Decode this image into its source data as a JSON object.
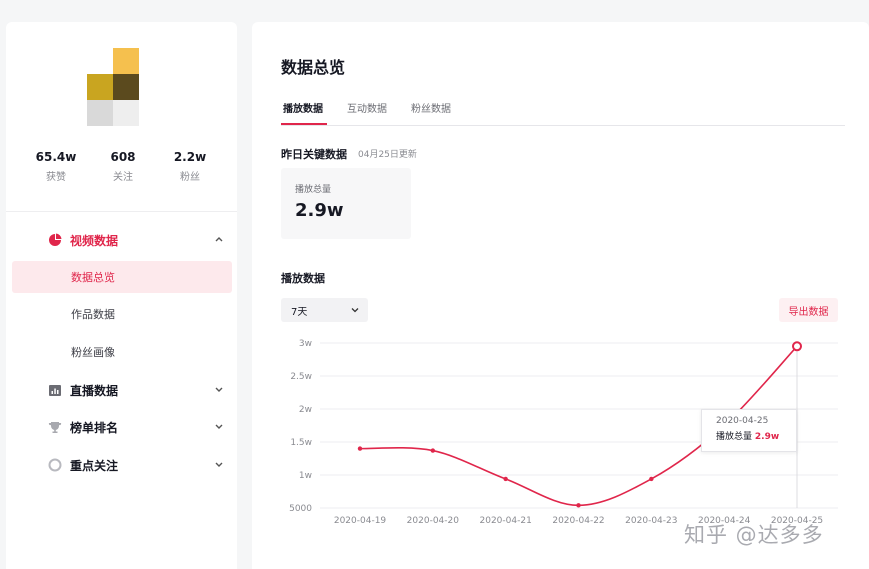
{
  "sidebar": {
    "stats": [
      {
        "value": "65.4w",
        "label": "获赞"
      },
      {
        "value": "608",
        "label": "关注"
      },
      {
        "value": "2.2w",
        "label": "粉丝"
      }
    ],
    "groups": [
      {
        "label": "视频数据",
        "icon": "pie-chart-icon",
        "expanded": true,
        "items": [
          {
            "label": "数据总览",
            "active": true
          },
          {
            "label": "作品数据",
            "active": false
          },
          {
            "label": "粉丝画像",
            "active": false
          }
        ]
      },
      {
        "label": "直播数据",
        "icon": "bar-chart-icon",
        "expanded": false
      },
      {
        "label": "榜单排名",
        "icon": "trophy-icon",
        "expanded": false
      },
      {
        "label": "重点关注",
        "icon": "circle-icon",
        "expanded": false
      }
    ]
  },
  "main": {
    "title": "数据总览",
    "tabs": [
      "播放数据",
      "互动数据",
      "粉丝数据"
    ],
    "active_tab": 0,
    "key_data": {
      "title": "昨日关键数据",
      "updated": "04月25日更新",
      "card_label": "播放总量",
      "card_value": "2.9w"
    },
    "playback": {
      "title": "播放数据",
      "range_select": "7天",
      "export_label": "导出数据"
    },
    "tooltip": {
      "date": "2020-04-25",
      "label": "播放总量",
      "value": "2.9w"
    }
  },
  "chart_data": {
    "type": "line",
    "title": "",
    "xlabel": "",
    "ylabel": "",
    "x": [
      "2020-04-19",
      "2020-04-20",
      "2020-04-21",
      "2020-04-22",
      "2020-04-23",
      "2020-04-24",
      "2020-04-25"
    ],
    "series": [
      {
        "values": [
          14000,
          13700,
          9400,
          5400,
          9400,
          17500,
          29500
        ]
      }
    ],
    "y_ticks": [
      5000,
      10000,
      15000,
      20000,
      25000,
      30000
    ],
    "y_tick_labels": [
      "5000",
      "1w",
      "1.5w",
      "2w",
      "2.5w",
      "3w"
    ],
    "ylim": [
      5000,
      30000
    ],
    "grid": true,
    "line_color": "#e0264b",
    "highlight_index": 6
  },
  "watermark": "知乎 @达多多"
}
